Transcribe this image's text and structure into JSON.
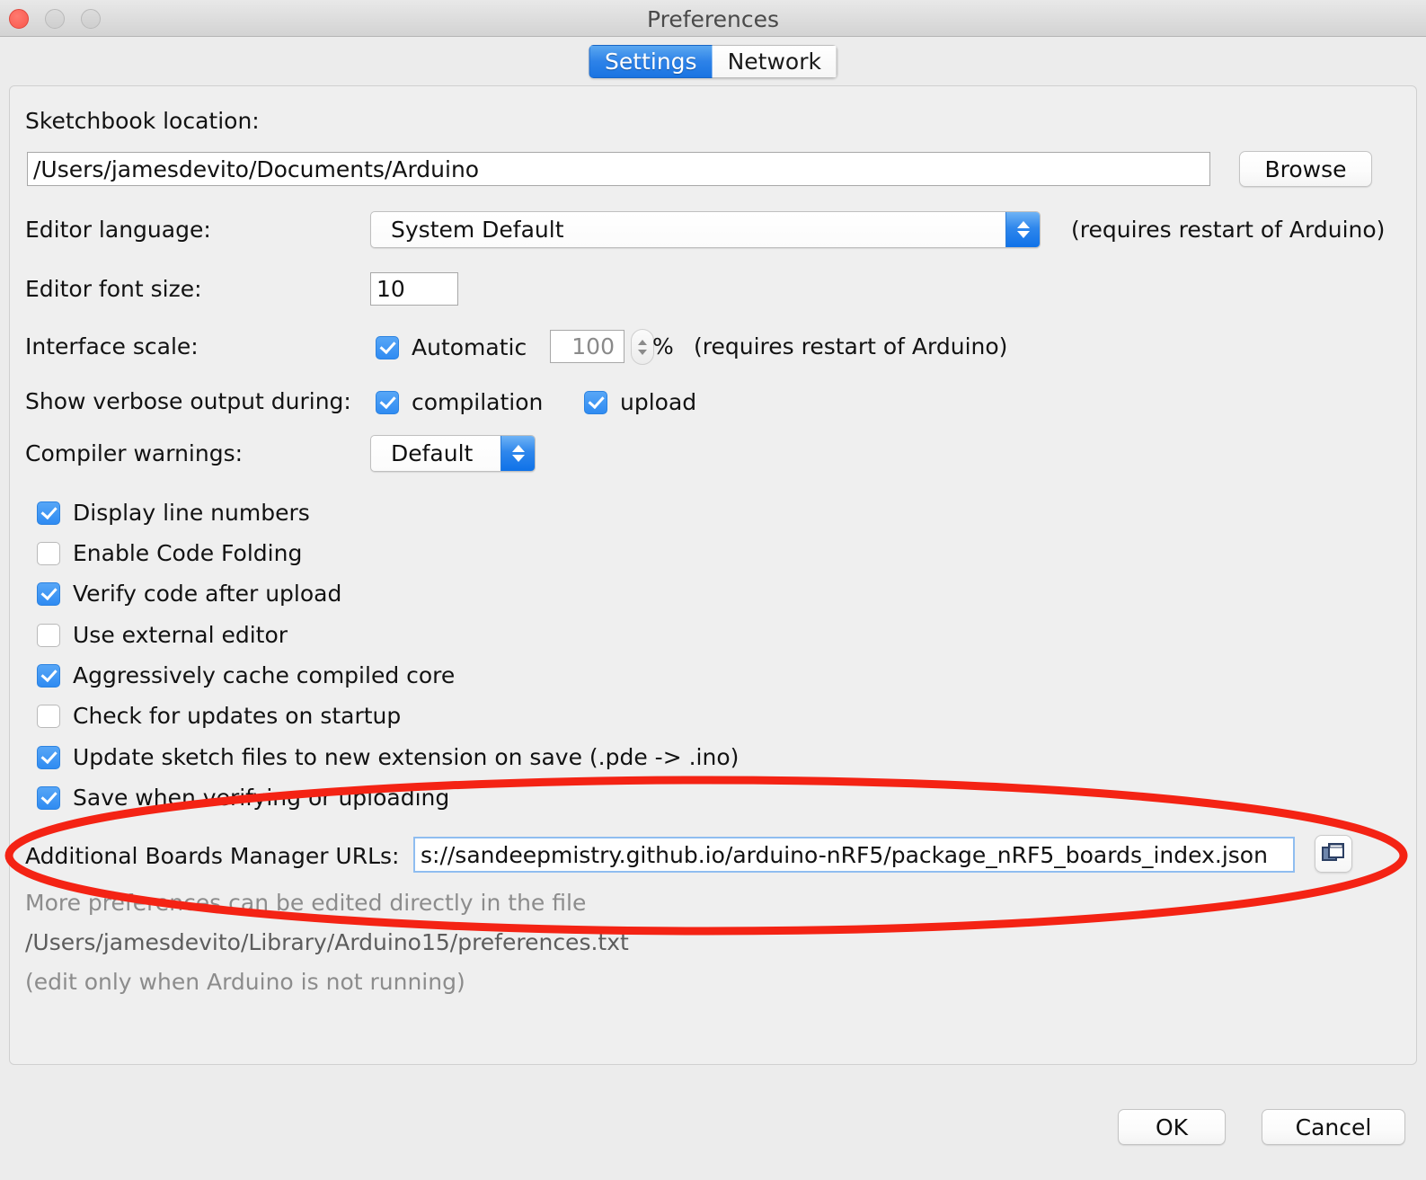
{
  "window": {
    "title": "Preferences",
    "traffic_lights": [
      "close",
      "minimize",
      "maximize"
    ]
  },
  "tabs": [
    {
      "label": "Settings",
      "active": true
    },
    {
      "label": "Network",
      "active": false
    }
  ],
  "settings": {
    "sketchbook": {
      "label": "Sketchbook location:",
      "value": "/Users/jamesdevito/Documents/Arduino",
      "browse_label": "Browse"
    },
    "editor_language": {
      "label": "Editor language:",
      "value": "System Default",
      "note": "(requires restart of Arduino)"
    },
    "editor_font_size": {
      "label": "Editor font size:",
      "value": "10"
    },
    "interface_scale": {
      "label": "Interface scale:",
      "automatic_label": "Automatic",
      "automatic_checked": true,
      "value": "100",
      "unit": "%",
      "note": "(requires restart of Arduino)"
    },
    "verbose_output": {
      "label": "Show verbose output during:",
      "options": [
        {
          "label": "compilation",
          "checked": true
        },
        {
          "label": "upload",
          "checked": true
        }
      ]
    },
    "compiler_warnings": {
      "label": "Compiler warnings:",
      "value": "Default"
    },
    "checkboxes": [
      {
        "label": "Display line numbers",
        "checked": true
      },
      {
        "label": "Enable Code Folding",
        "checked": false
      },
      {
        "label": "Verify code after upload",
        "checked": true
      },
      {
        "label": "Use external editor",
        "checked": false
      },
      {
        "label": "Aggressively cache compiled core",
        "checked": true
      },
      {
        "label": "Check for updates on startup",
        "checked": false
      },
      {
        "label": "Update sketch files to new extension on save (.pde -> .ino)",
        "checked": true
      },
      {
        "label": "Save when verifying or uploading",
        "checked": true
      }
    ],
    "boards_manager": {
      "label": "Additional Boards Manager URLs:",
      "value": "s://sandeepmistry.github.io/arduino-nRF5/package_nRF5_boards_index.json",
      "expand_icon": "windows-cascade-icon"
    },
    "footer": {
      "line1": "More preferences can be edited directly in the file",
      "line2": "/Users/jamesdevito/Library/Arduino15/preferences.txt",
      "line3": "(edit only when Arduino is not running)"
    }
  },
  "footer_buttons": {
    "ok": "OK",
    "cancel": "Cancel"
  },
  "annotation": {
    "type": "ellipse-highlight",
    "color": "#f42314"
  },
  "colors": {
    "accent_blue": "#2f87ec",
    "annotation_red": "#f42314",
    "window_bg": "#ececec",
    "panel_bg": "#efefef"
  }
}
